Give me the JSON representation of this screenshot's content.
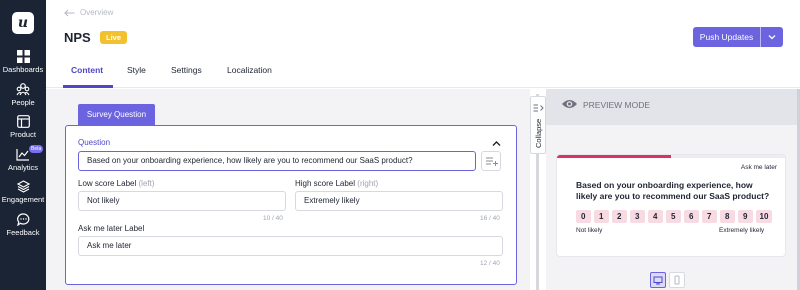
{
  "sidebar": {
    "logo_letter": "u",
    "items": [
      {
        "label": "Dashboards",
        "icon": "grid-icon"
      },
      {
        "label": "People",
        "icon": "people-icon"
      },
      {
        "label": "Product",
        "icon": "product-icon"
      },
      {
        "label": "Analytics",
        "icon": "analytics-icon",
        "badge": "Beta"
      },
      {
        "label": "Engagement",
        "icon": "layers-icon"
      },
      {
        "label": "Feedback",
        "icon": "chat-bubble-icon"
      }
    ]
  },
  "header": {
    "back_label": "Overview",
    "title": "NPS",
    "status_badge": "Live",
    "push_button": "Push Updates"
  },
  "tabs": [
    "Content",
    "Style",
    "Settings",
    "Localization"
  ],
  "active_tab": "Content",
  "editor": {
    "section_tab": "Survey Question",
    "question_label": "Question",
    "question_value": "Based on your onboarding experience, how likely are you to recommend our SaaS product?",
    "low_label": "Low score Label",
    "low_hint": "(left)",
    "low_value": "Not likely",
    "low_count": "10 / 40",
    "high_label": "High score Label",
    "high_hint": "(right)",
    "high_value": "Extremely likely",
    "high_count": "16 / 40",
    "ask_label": "Ask me later Label",
    "ask_value": "Ask me later",
    "ask_count": "12 / 40"
  },
  "collapse_label": "Collapse",
  "preview": {
    "mode_label": "PREVIEW MODE",
    "ask_later": "Ask me later",
    "question": "Based on your onboarding experience, how likely are you to recommend our SaaS product?",
    "scale": [
      "0",
      "1",
      "2",
      "3",
      "4",
      "5",
      "6",
      "7",
      "8",
      "9",
      "10"
    ],
    "low_text": "Not likely",
    "high_text": "Extremely likely",
    "progress": 0.5
  },
  "colors": {
    "sidebar": "#1b2434",
    "accent": "#6b63e0",
    "live": "#f2c12e",
    "score_bg": "#f8dbe2",
    "progress": "#e0305f"
  }
}
